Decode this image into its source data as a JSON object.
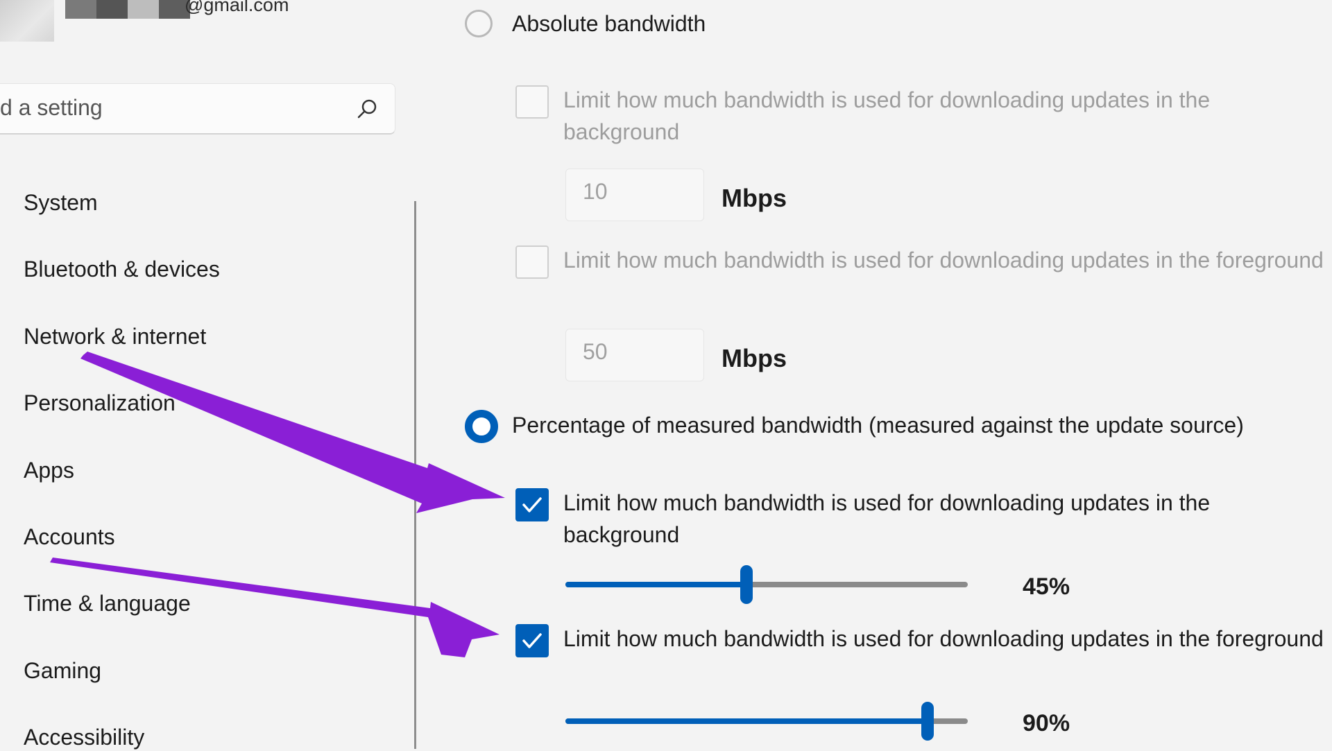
{
  "account": {
    "email": "@gmail.com"
  },
  "search": {
    "text": "d a setting"
  },
  "sidebar": {
    "items": [
      {
        "label": "System"
      },
      {
        "label": "Bluetooth & devices"
      },
      {
        "label": "Network & internet"
      },
      {
        "label": "Personalization"
      },
      {
        "label": "Apps"
      },
      {
        "label": "Accounts"
      },
      {
        "label": "Time & language"
      },
      {
        "label": "Gaming"
      },
      {
        "label": "Accessibility"
      }
    ]
  },
  "main": {
    "absolute": {
      "label": "Absolute bandwidth",
      "selected": false,
      "background": {
        "label": "Limit how much bandwidth is used for downloading updates in the background",
        "checked": false,
        "value": "10",
        "unit": "Mbps"
      },
      "foreground": {
        "label": "Limit how much bandwidth is used for downloading updates in the foreground",
        "checked": false,
        "value": "50",
        "unit": "Mbps"
      }
    },
    "percentage": {
      "label": "Percentage of measured bandwidth (measured against the update source)",
      "selected": true,
      "background": {
        "label": "Limit how much bandwidth is used for downloading updates in the background",
        "checked": true,
        "slider_percent": 45,
        "value_label": "45%"
      },
      "foreground": {
        "label": "Limit how much bandwidth is used for downloading updates in the foreground",
        "checked": true,
        "slider_percent": 90,
        "value_label": "90%"
      }
    }
  },
  "colors": {
    "accent": "#005fb8",
    "annotation_arrow": "#8a1fd6",
    "background": "#f3f3f3"
  }
}
